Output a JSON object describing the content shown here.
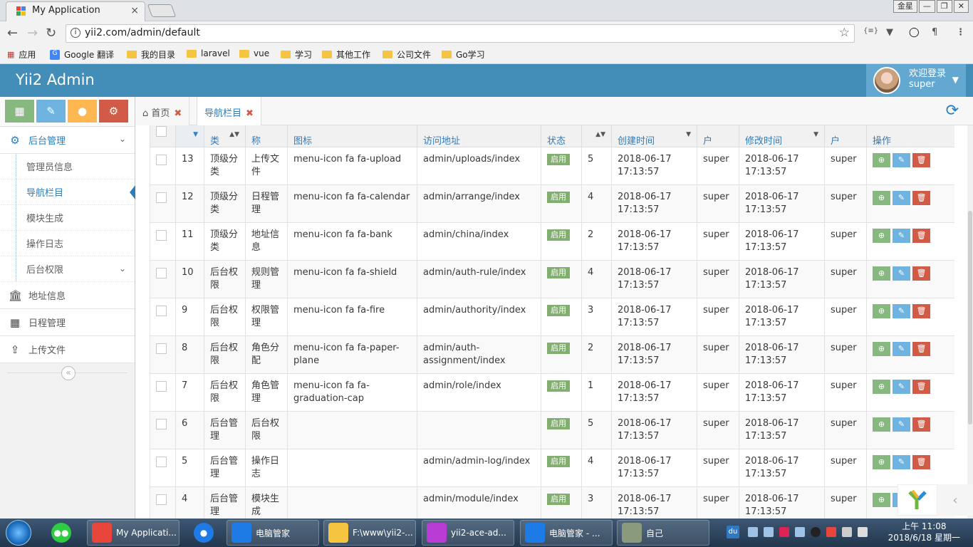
{
  "browser": {
    "tab_title": "My Application",
    "tab_close": "×",
    "window_user": "金星",
    "win_min": "—",
    "win_max": "❐",
    "win_close": "✕",
    "url": "yii2.com/admin/default",
    "bookmarks": [
      "应用",
      "Google 翻译",
      "我的目录",
      "laravel",
      "vue",
      "学习",
      "其他工作",
      "公司文件",
      "Go学习"
    ]
  },
  "header": {
    "brand": "Yii2 Admin",
    "welcome": "欢迎登录",
    "username": "super"
  },
  "sidebar": {
    "shortcut_colors": [
      "#87b87f",
      "#6fb3e0",
      "#ffb752",
      "#d15b47"
    ],
    "group": "后台管理",
    "subitems": [
      "管理员信息",
      "导航栏目",
      "模块生成",
      "操作日志",
      "后台权限"
    ],
    "items": [
      "地址信息",
      "日程管理",
      "上传文件"
    ],
    "collapse": "«"
  },
  "page_tabs": [
    {
      "label": "首页"
    },
    {
      "label": "导航栏目"
    }
  ],
  "table": {
    "headers": [
      "",
      "",
      "类",
      "称",
      "图标",
      "访问地址",
      "状态",
      "",
      "创建时间",
      "户",
      "修改时间",
      "户",
      "操作"
    ],
    "rows": [
      {
        "id": "13",
        "type": "顶级分类",
        "name": "上传文件",
        "icon": "menu-icon fa fa-upload",
        "url": "admin/uploads/index",
        "status": "启用",
        "sort": "5",
        "created": "2018-06-17 17:13:57",
        "cuser": "super",
        "updated": "2018-06-17 17:13:57",
        "uuser": "super"
      },
      {
        "id": "12",
        "type": "顶级分类",
        "name": "日程管理",
        "icon": "menu-icon fa fa-calendar",
        "url": "admin/arrange/index",
        "status": "启用",
        "sort": "4",
        "created": "2018-06-17 17:13:57",
        "cuser": "super",
        "updated": "2018-06-17 17:13:57",
        "uuser": "super"
      },
      {
        "id": "11",
        "type": "顶级分类",
        "name": "地址信息",
        "icon": "menu-icon fa fa-bank",
        "url": "admin/china/index",
        "status": "启用",
        "sort": "2",
        "created": "2018-06-17 17:13:57",
        "cuser": "super",
        "updated": "2018-06-17 17:13:57",
        "uuser": "super"
      },
      {
        "id": "10",
        "type": "后台权限",
        "name": "规则管理",
        "icon": "menu-icon fa fa-shield",
        "url": "admin/auth-rule/index",
        "status": "启用",
        "sort": "4",
        "created": "2018-06-17 17:13:57",
        "cuser": "super",
        "updated": "2018-06-17 17:13:57",
        "uuser": "super"
      },
      {
        "id": "9",
        "type": "后台权限",
        "name": "权限管理",
        "icon": "menu-icon fa fa-fire",
        "url": "admin/authority/index",
        "status": "启用",
        "sort": "3",
        "created": "2018-06-17 17:13:57",
        "cuser": "super",
        "updated": "2018-06-17 17:13:57",
        "uuser": "super"
      },
      {
        "id": "8",
        "type": "后台权限",
        "name": "角色分配",
        "icon": "menu-icon fa fa-paper-plane",
        "url": "admin/auth-assignment/index",
        "status": "启用",
        "sort": "2",
        "created": "2018-06-17 17:13:57",
        "cuser": "super",
        "updated": "2018-06-17 17:13:57",
        "uuser": "super"
      },
      {
        "id": "7",
        "type": "后台权限",
        "name": "角色管理",
        "icon": "menu-icon fa fa-graduation-cap",
        "url": "admin/role/index",
        "status": "启用",
        "sort": "1",
        "created": "2018-06-17 17:13:57",
        "cuser": "super",
        "updated": "2018-06-17 17:13:57",
        "uuser": "super"
      },
      {
        "id": "6",
        "type": "后台管理",
        "name": "后台权限",
        "icon": "",
        "url": "",
        "status": "启用",
        "sort": "5",
        "created": "2018-06-17 17:13:57",
        "cuser": "super",
        "updated": "2018-06-17 17:13:57",
        "uuser": "super"
      },
      {
        "id": "5",
        "type": "后台管理",
        "name": "操作日志",
        "icon": "",
        "url": "admin/admin-log/index",
        "status": "启用",
        "sort": "4",
        "created": "2018-06-17 17:13:57",
        "cuser": "super",
        "updated": "2018-06-17 17:13:57",
        "uuser": "super"
      },
      {
        "id": "4",
        "type": "后台管理",
        "name": "模块生成",
        "icon": "",
        "url": "admin/module/index",
        "status": "启用",
        "sort": "3",
        "created": "2018-06-17 17:13:57",
        "cuser": "super",
        "updated": "2018-06-17 17:13:57",
        "uuser": "super"
      }
    ]
  },
  "taskbar": {
    "items": [
      {
        "label": "My Applicati...",
        "icon": "chrome-icon",
        "color": "#e8453c"
      },
      {
        "label": "电脑管家",
        "icon": "shield-icon",
        "color": "#1e7be6"
      },
      {
        "label": "F:\\www\\yii2-...",
        "icon": "folder-icon",
        "color": "#f5c542"
      },
      {
        "label": "yii2-ace-ad...",
        "icon": "phpstorm-icon",
        "color": "#b83bd4"
      },
      {
        "label": "电脑管家 - ...",
        "icon": "shield-icon",
        "color": "#1e7be6"
      },
      {
        "label": "自己",
        "icon": "photo-icon",
        "color": "#8a9a7c"
      }
    ],
    "tray_du": "du",
    "time": "上午 11:08",
    "date": "2018/6/18 星期一"
  }
}
